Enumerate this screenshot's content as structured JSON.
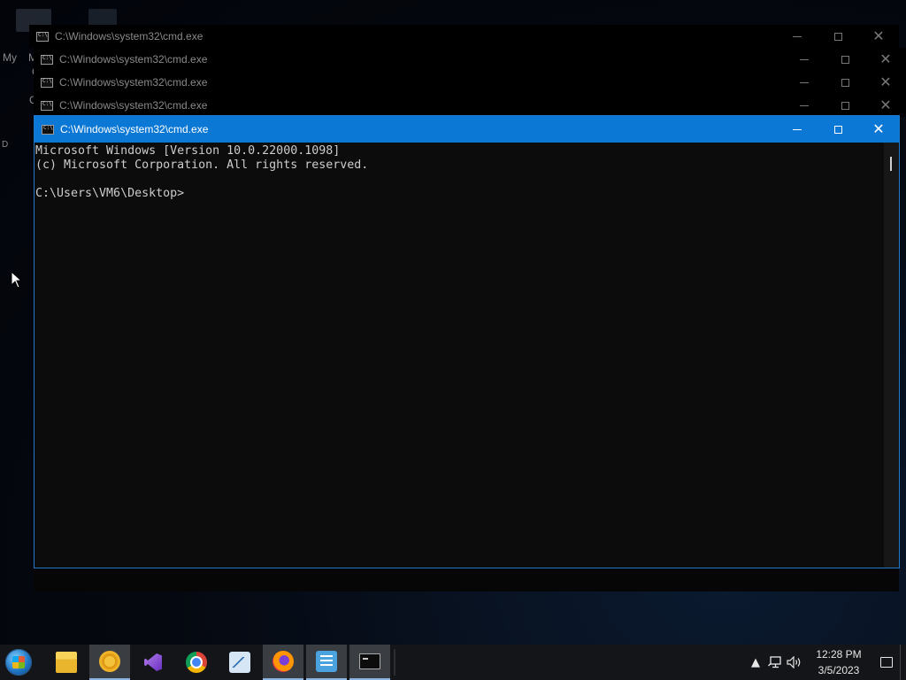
{
  "desktop": {
    "fragments": [
      "My",
      "M",
      "C",
      "C",
      "D"
    ]
  },
  "windows": {
    "background_titles": [
      "C:\\Windows\\system32\\cmd.exe",
      "C:\\Windows\\system32\\cmd.exe",
      "C:\\Windows\\system32\\cmd.exe",
      "C:\\Windows\\system32\\cmd.exe"
    ],
    "active": {
      "title": "C:\\Windows\\system32\\cmd.exe",
      "console_lines": [
        "Microsoft Windows [Version 10.0.22000.1098]",
        "(c) Microsoft Corporation. All rights reserved.",
        "",
        "C:\\Users\\VM6\\Desktop>"
      ],
      "titlebar_color": "#0a78d4"
    }
  },
  "taskbar": {
    "pinned_icons": [
      "folder-icon",
      "ring-icon",
      "visual-studio-icon",
      "chrome-icon",
      "resource-monitor-icon",
      "firefox-icon",
      "notepad-icon",
      "cmd-icon"
    ],
    "tray": {
      "time": "12:28 PM",
      "date": "3/5/2023"
    }
  }
}
